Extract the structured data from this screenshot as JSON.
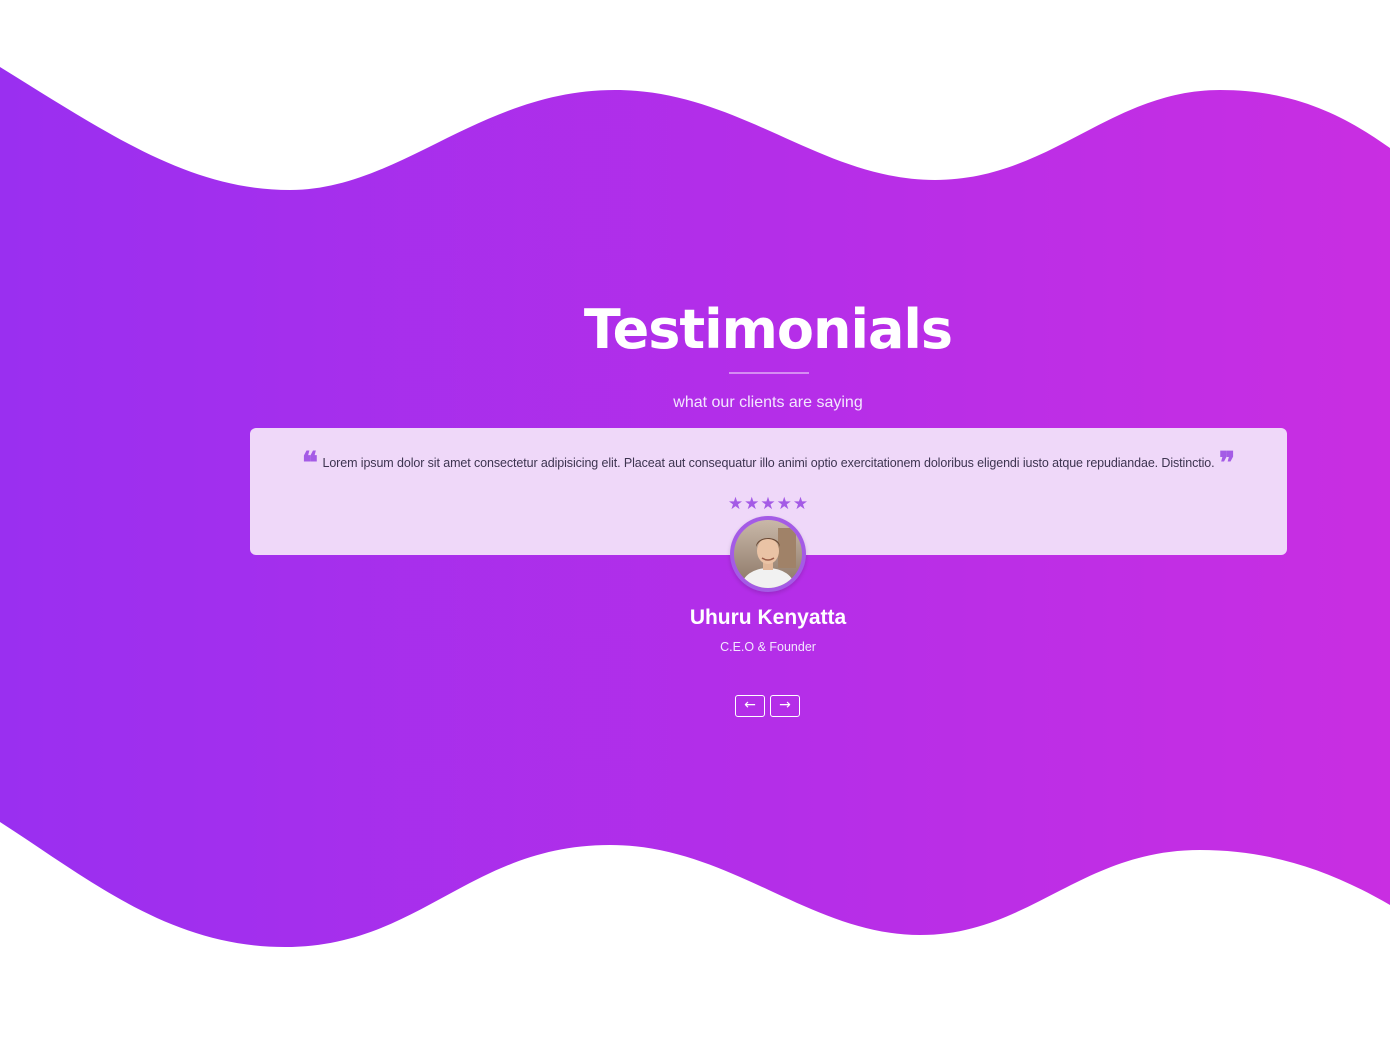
{
  "section": {
    "title": "Testimonials",
    "subtitle": "what our clients are saying"
  },
  "testimonial": {
    "open_quote": "❝",
    "close_quote": "❞",
    "text": "Lorem ipsum dolor sit amet consectetur adipisicing elit. Placeat aut consequatur illo animi optio exercitationem doloribus eligendi iusto atque repudiandae. Distinctio.",
    "rating": 5,
    "stars": "★★★★★",
    "author_name": "Uhuru Kenyatta",
    "author_role": "C.E.O & Founder",
    "avatar_icon": "person-avatar"
  },
  "navigation": {
    "prev_label": "←",
    "next_label": "→",
    "prev_icon": "arrow-left-icon",
    "next_icon": "arrow-right-icon"
  },
  "colors": {
    "gradient_start": "#9a2ff0",
    "gradient_end": "#c92ee2",
    "card_background": "#efd8f9",
    "accent": "#a45be6",
    "text_light": "#ffffff"
  }
}
